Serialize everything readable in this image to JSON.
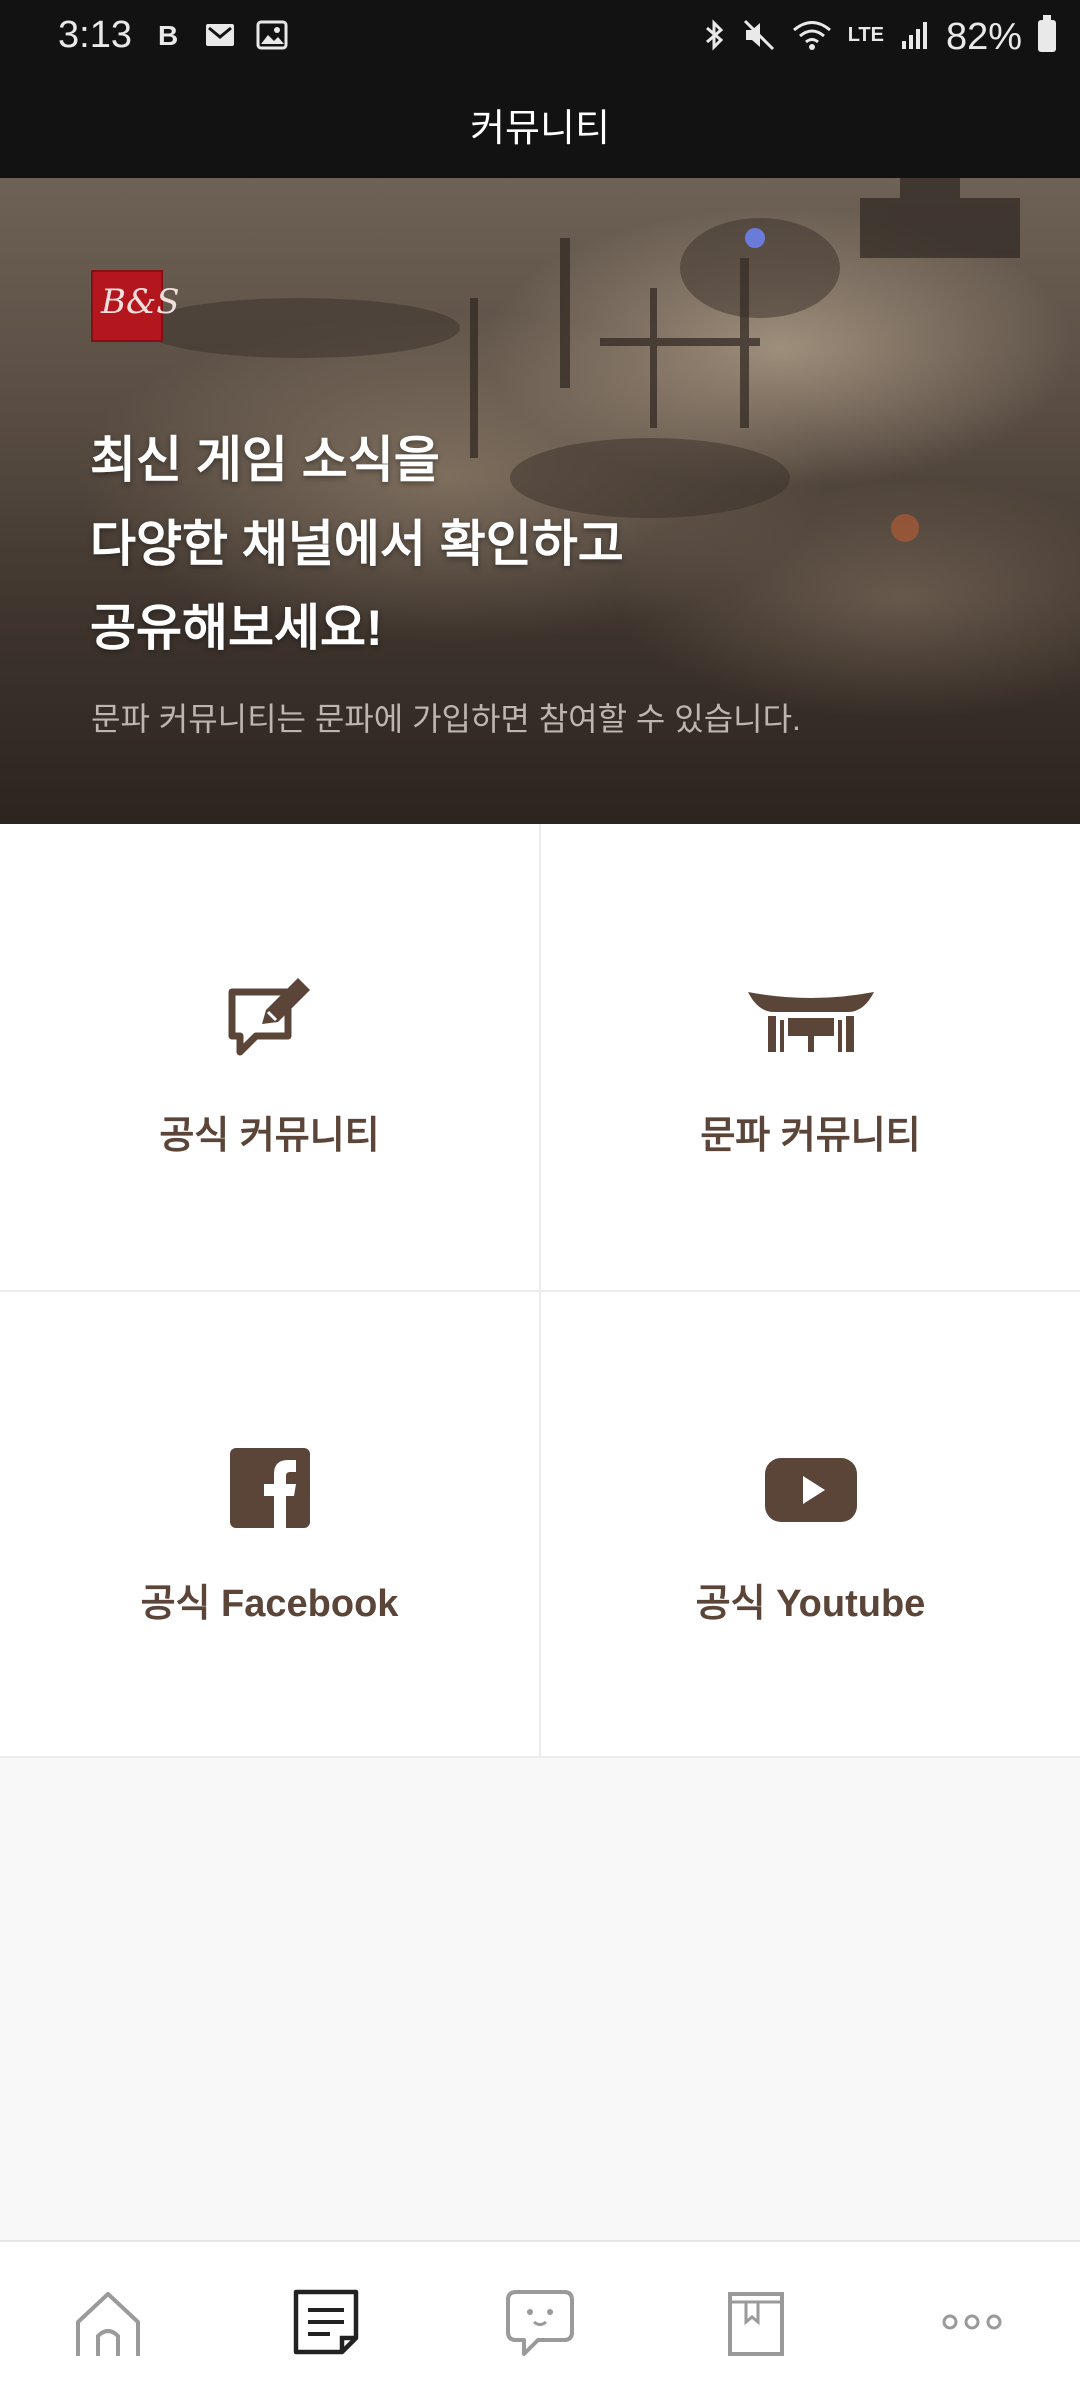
{
  "status_bar": {
    "time": "3:13",
    "battery": "82%",
    "network": "LTE",
    "left_icons": [
      "b-icon",
      "mail-icon",
      "image-icon"
    ],
    "right_icons": [
      "bluetooth-icon",
      "mute-icon",
      "wifi-icon",
      "lte-icon",
      "signal-icon",
      "battery-icon"
    ]
  },
  "header": {
    "title": "커뮤니티"
  },
  "hero": {
    "logo_text": "B&S",
    "headline_line1": "최신 게임 소식을",
    "headline_line2": "다양한 채널에서 확인하고",
    "headline_line3": "공유해보세요!",
    "subtext": "문파 커뮤니티는 문파에 가입하면 참여할 수 있습니다."
  },
  "grid": {
    "items": [
      {
        "label": "공식 커뮤니티",
        "icon": "edit-chat-icon"
      },
      {
        "label": "문파 커뮤니티",
        "icon": "gate-icon"
      },
      {
        "label": "공식 Facebook",
        "icon": "facebook-icon"
      },
      {
        "label": "공식 Youtube",
        "icon": "youtube-icon"
      }
    ]
  },
  "bottom_nav": {
    "items": [
      "home-icon",
      "board-icon",
      "chat-icon",
      "book-icon",
      "more-icon"
    ],
    "active": "board-icon"
  },
  "colors": {
    "accent": "#5b4538",
    "header_bg": "#121212"
  }
}
